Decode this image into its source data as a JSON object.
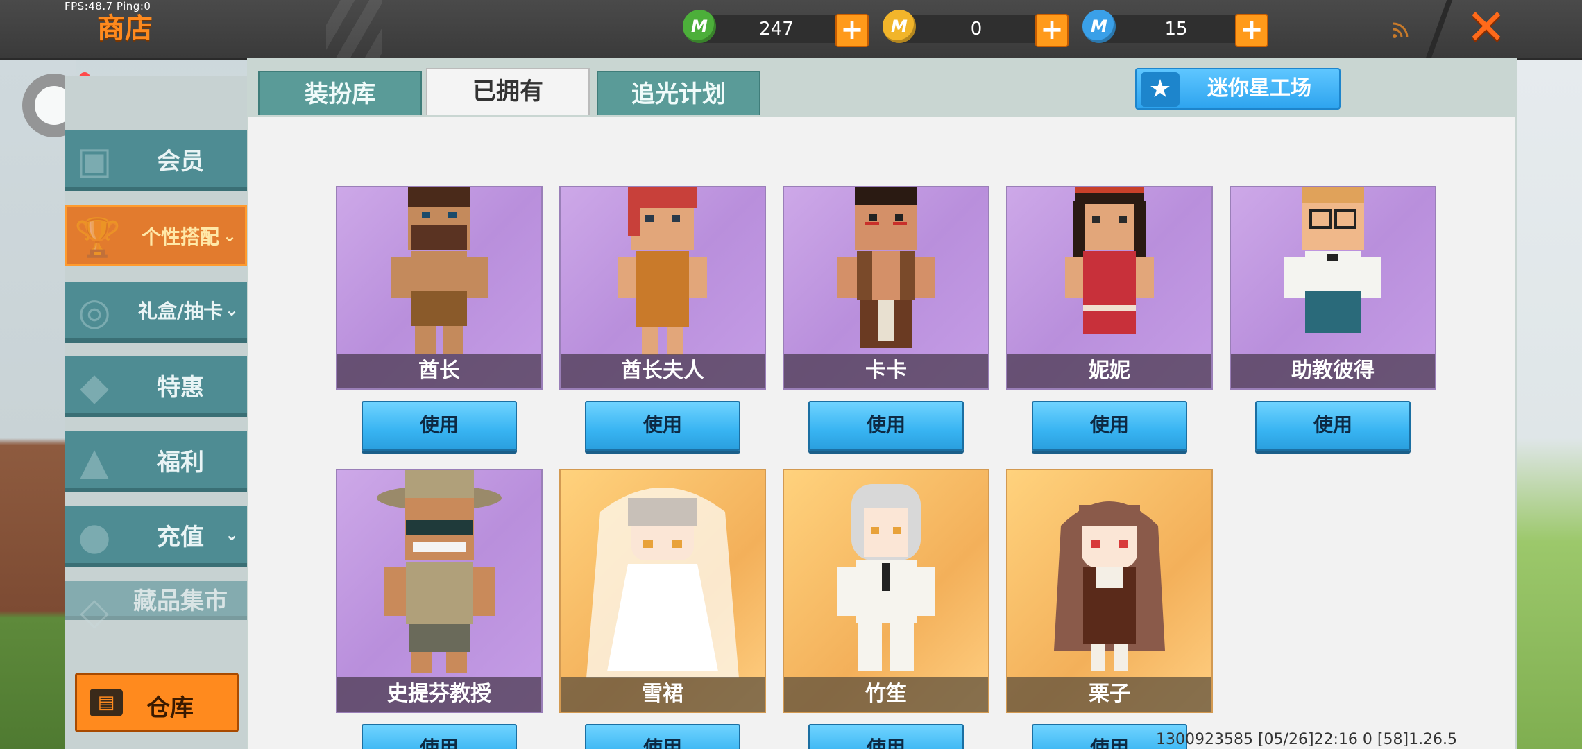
{
  "debug": {
    "fps_text": "FPS:48.7  Ping:0"
  },
  "header": {
    "title": "商店",
    "currencies": [
      {
        "icon": "green-m-coin-icon",
        "value": "247",
        "color": "#4caf3a"
      },
      {
        "icon": "gold-m-coin-icon",
        "value": "0",
        "color": "#f2b52a"
      },
      {
        "icon": "blue-m-coin-icon",
        "value": "15",
        "color": "#3aa0e8"
      }
    ],
    "plus_label": "+",
    "close_label": "✕"
  },
  "sidebar": {
    "items": [
      {
        "label": "会员",
        "icon": "member-icon"
      },
      {
        "label": "个性搭配",
        "icon": "trophy-icon",
        "active": true,
        "chevron": "⌄"
      },
      {
        "label": "礼盒/抽卡",
        "icon": "gift-disc-icon",
        "chevron": "⌄"
      },
      {
        "label": "特惠",
        "icon": "box-icon"
      },
      {
        "label": "福利",
        "icon": "present-icon"
      },
      {
        "label": "充值",
        "icon": "coins-icon",
        "chevron": "⌄"
      },
      {
        "label": "藏品集市",
        "icon": "market-icon"
      }
    ],
    "warehouse_label": "仓库"
  },
  "tabs": [
    {
      "label": "装扮库"
    },
    {
      "label": "已拥有",
      "active": true
    },
    {
      "label": "追光计划"
    }
  ],
  "studio_button": {
    "label": "迷你星工场"
  },
  "cards": [
    {
      "name": "酋长",
      "style": "purple",
      "button": "使用"
    },
    {
      "name": "酋长夫人",
      "style": "purple",
      "button": "使用"
    },
    {
      "name": "卡卡",
      "style": "purple",
      "button": "使用"
    },
    {
      "name": "妮妮",
      "style": "purple",
      "button": "使用"
    },
    {
      "name": "助教彼得",
      "style": "purple",
      "button": "使用"
    },
    {
      "name": "史提芬教授",
      "style": "purple",
      "button": "使用"
    },
    {
      "name": "雪裙",
      "style": "orange",
      "button": "使用"
    },
    {
      "name": "竹笙",
      "style": "orange",
      "button": "使用"
    },
    {
      "name": "栗子",
      "style": "orange",
      "button": "使用"
    }
  ],
  "footer": {
    "info": "1300923585   [05/26]22:16 0  [58]1.26.5"
  }
}
